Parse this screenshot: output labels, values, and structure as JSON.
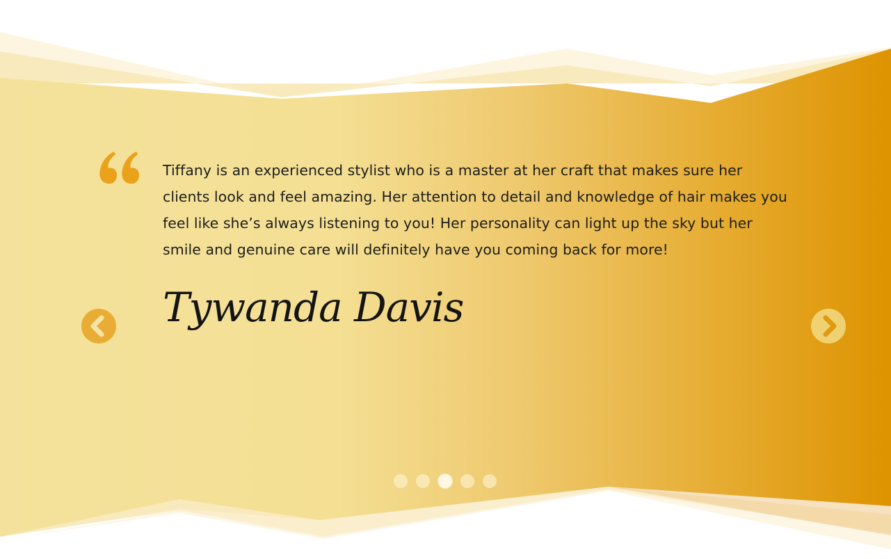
{
  "colors": {
    "background": "#ffffff",
    "gradient_light": "#f4e19a",
    "gradient_dark": "#de9300",
    "accent": "#e9a21a",
    "text": "#1d1d1d"
  },
  "testimonial": {
    "quote_icon": "quote-open-icon",
    "text": "Tiffany is an experienced stylist who is a master at her craft that makes sure her clients look and feel amazing. Her attention to detail and knowledge of hair makes you feel like she’s always listening to you! Her personality can light up the sky but her smile and genuine care will definitely have you coming back for more!",
    "author": "Tywanda Davis"
  },
  "carousel": {
    "prev_icon": "chevron-left-icon",
    "next_icon": "chevron-right-icon",
    "slide_count": 5,
    "active_slide": 3
  }
}
